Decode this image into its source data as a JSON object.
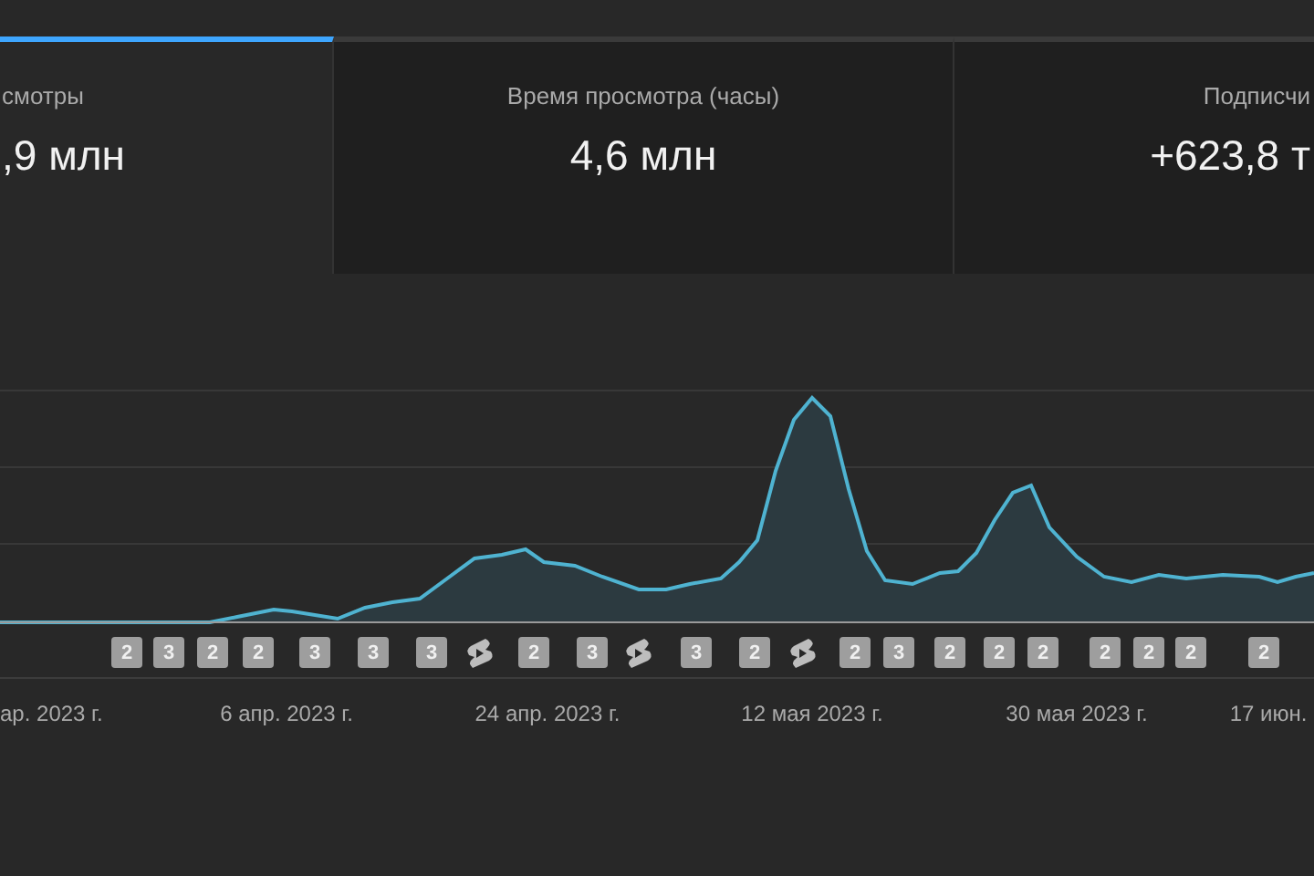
{
  "metric_tabs": [
    {
      "label": "смотры",
      "value": ",9 млн",
      "selected": true
    },
    {
      "label": "Время просмотра (часы)",
      "value": "4,6 млн",
      "selected": false
    },
    {
      "label": "Подписчи",
      "value": "+623,8 т",
      "selected": false
    }
  ],
  "video_markers": [
    {
      "kind": "count",
      "text": "2"
    },
    {
      "kind": "count",
      "text": "3"
    },
    {
      "kind": "count",
      "text": "2"
    },
    {
      "kind": "count",
      "text": "2"
    },
    {
      "kind": "count",
      "text": "3"
    },
    {
      "kind": "count",
      "text": "3"
    },
    {
      "kind": "count",
      "text": "3"
    },
    {
      "kind": "shorts"
    },
    {
      "kind": "count",
      "text": "2"
    },
    {
      "kind": "count",
      "text": "3"
    },
    {
      "kind": "shorts"
    },
    {
      "kind": "count",
      "text": "3"
    },
    {
      "kind": "count",
      "text": "2"
    },
    {
      "kind": "shorts"
    },
    {
      "kind": "count",
      "text": "2"
    },
    {
      "kind": "count",
      "text": "3"
    },
    {
      "kind": "count",
      "text": "2"
    },
    {
      "kind": "count",
      "text": "2"
    },
    {
      "kind": "count",
      "text": "2"
    },
    {
      "kind": "count",
      "text": "2"
    },
    {
      "kind": "count",
      "text": "2"
    },
    {
      "kind": "count",
      "text": "2"
    },
    {
      "kind": "count",
      "text": "2"
    }
  ],
  "x_axis_dates": [
    "ар. 2023 г.",
    "6 апр. 2023 г.",
    "24 апр. 2023 г.",
    "12 мая 2023 г.",
    "30 мая 2023 г.",
    "17 июн."
  ]
}
